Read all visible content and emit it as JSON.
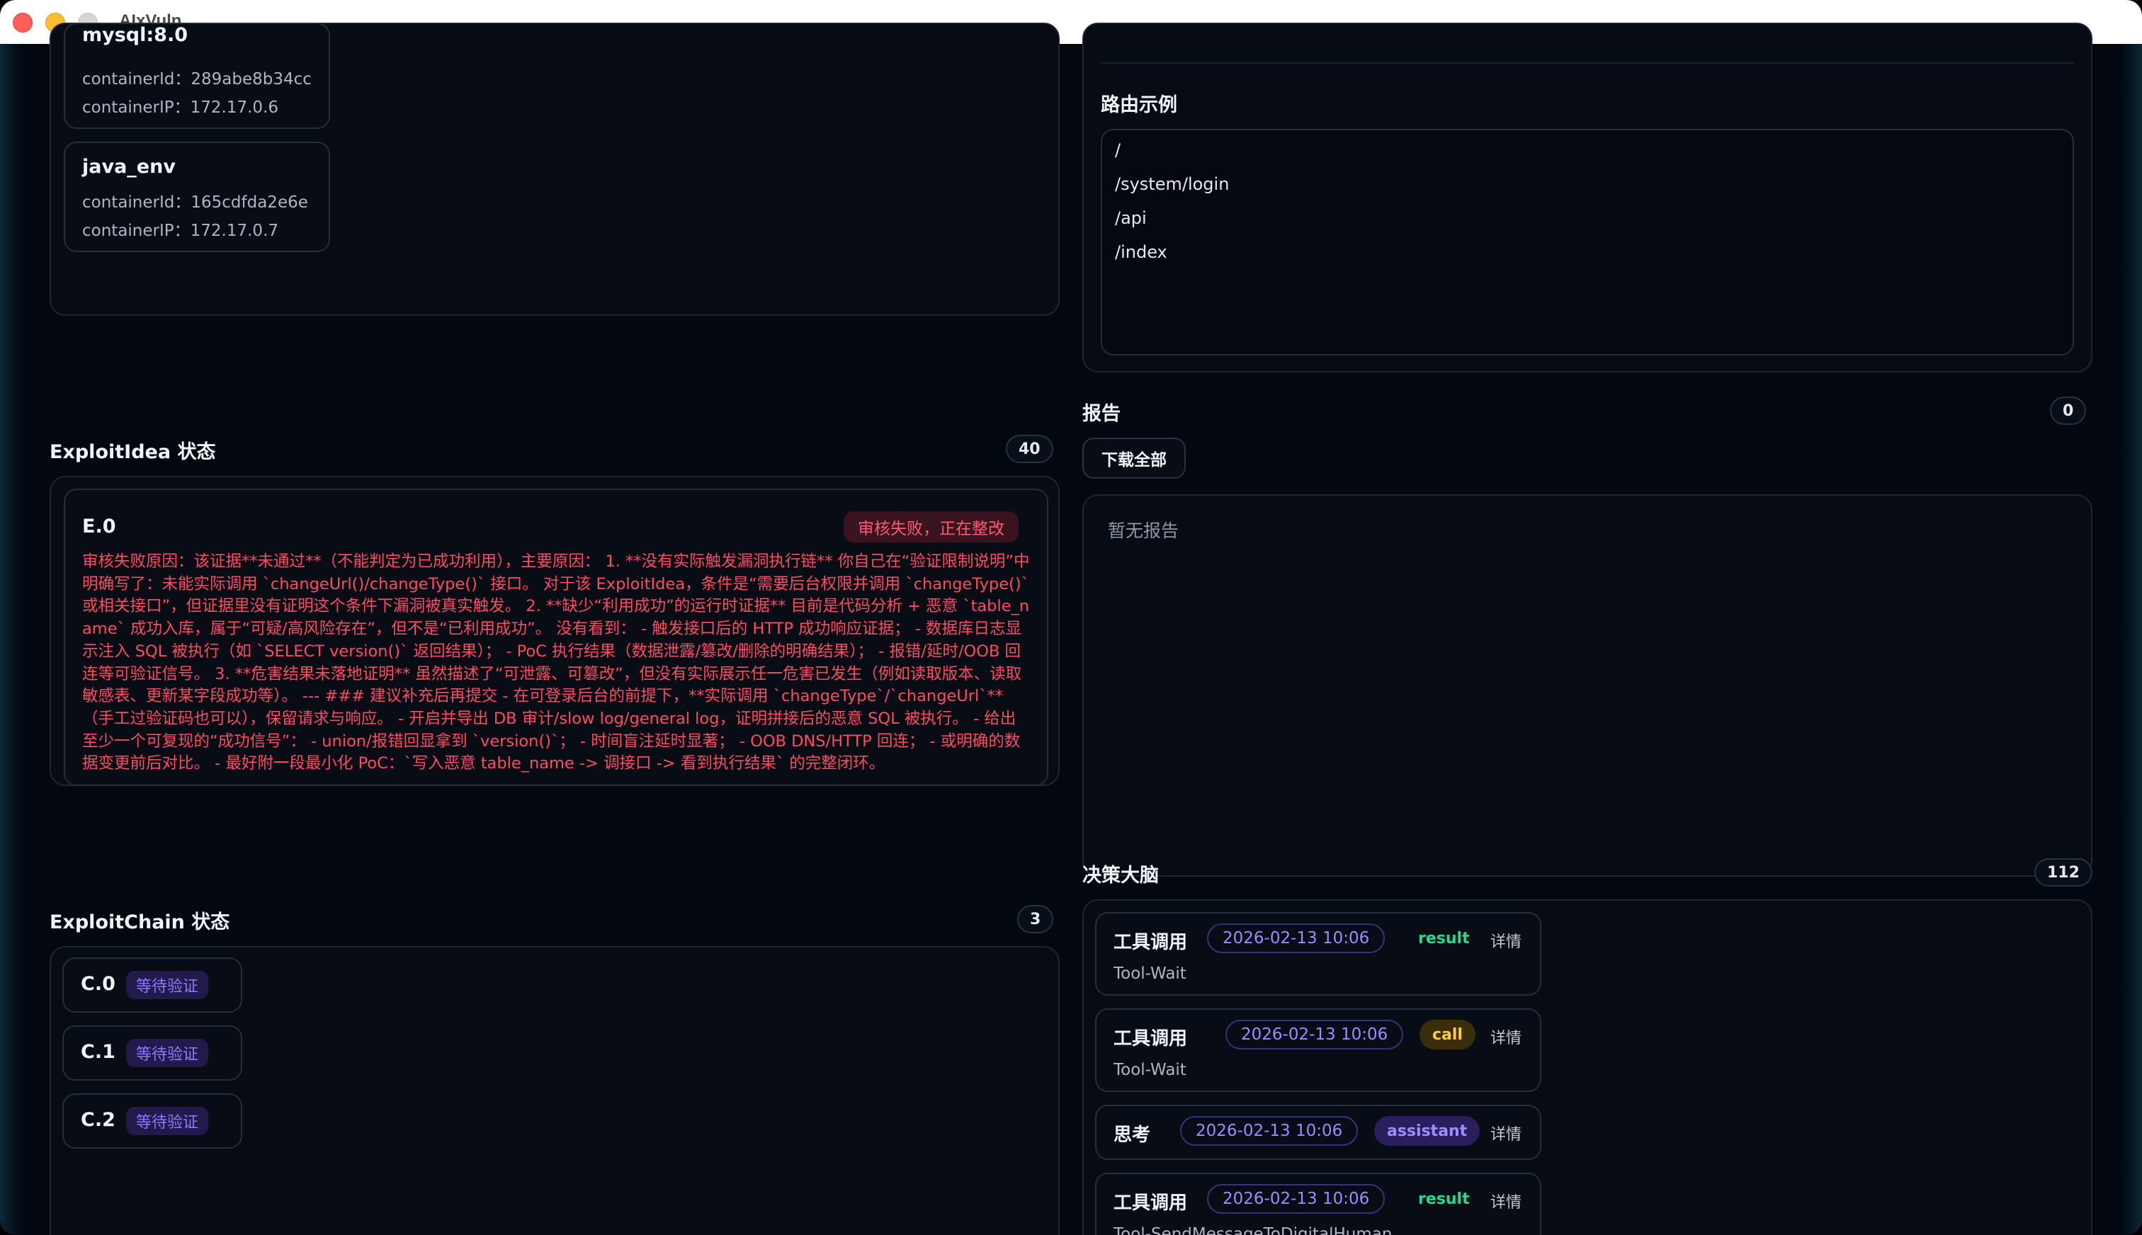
{
  "window": {
    "title": "AIxVuln"
  },
  "containers": [
    {
      "name": "mysql:8.0",
      "id_label": "containerId：",
      "id": "289abe8b34cc",
      "ip_label": "containerIP：",
      "ip": "172.17.0.6"
    },
    {
      "name": "java_env",
      "id_label": "containerId：",
      "id": "165cdfda2e6e",
      "ip_label": "containerIP：",
      "ip": "172.17.0.7"
    }
  ],
  "routes": {
    "title": "路由示例",
    "items": [
      "/",
      "/system/login",
      "/api",
      "/index"
    ]
  },
  "report": {
    "title": "报告",
    "count": "0",
    "download_label": "下载全部",
    "empty_text": "暂无报告"
  },
  "exploit_idea": {
    "title": "ExploitIdea 状态",
    "count": "40",
    "items": [
      {
        "id": "E.0",
        "status": "审核失败，正在整改",
        "text": "审核失败原因：该证据**未通过**（不能判定为已成功利用），主要原因： 1. **没有实际触发漏洞执行链** 你自己在“验证限制说明”中明确写了：未能实际调用 `changeUrl()/changeType()` 接口。 对于该 ExploitIdea，条件是“需要后台权限并调用 `changeType()` 或相关接口”，但证据里没有证明这个条件下漏洞被真实触发。 2. **缺少“利用成功”的运行时证据** 目前是代码分析 + 恶意 `table_name` 成功入库，属于“可疑/高风险存在”，但不是“已利用成功”。 没有看到： - 触发接口后的 HTTP 成功响应证据； - 数据库日志显示注入 SQL 被执行（如 `SELECT version()` 返回结果）； - PoC 执行结果（数据泄露/篡改/删除的明确结果）； - 报错/延时/OOB 回连等可验证信号。 3. **危害结果未落地证明** 虽然描述了“可泄露、可篡改”，但没有实际展示任一危害已发生（例如读取版本、读取敏感表、更新某字段成功等）。 --- ### 建议补充后再提交 - 在可登录后台的前提下，**实际调用 `changeType`/`changeUrl`**（手工过验证码也可以），保留请求与响应。 - 开启并导出 DB 审计/slow log/general log，证明拼接后的恶意 SQL 被执行。 - 给出至少一个可复现的“成功信号”： - union/报错回显拿到 `version()`； - 时间盲注延时显著； - OOB DNS/HTTP 回连； - 或明确的数据变更前后对比。 - 最好附一段最小化 PoC：`写入恶意 table_name -> 调接口 -> 看到执行结果` 的完整闭环。"
      }
    ]
  },
  "exploit_chain": {
    "title": "ExploitChain 状态",
    "count": "3",
    "items": [
      {
        "id": "C.0",
        "status": "等待验证"
      },
      {
        "id": "C.1",
        "status": "等待验证"
      },
      {
        "id": "C.2",
        "status": "等待验证"
      }
    ]
  },
  "decision": {
    "title": "决策大脑",
    "count": "112",
    "detail_label": "详情",
    "items": [
      {
        "kind": "工具调用",
        "time": "2026-02-13 10:06",
        "tag": "result",
        "sub": "Tool-Wait"
      },
      {
        "kind": "工具调用",
        "time": "2026-02-13 10:06",
        "tag": "call",
        "sub": "Tool-Wait"
      },
      {
        "kind": "思考",
        "time": "2026-02-13 10:06",
        "tag": "assistant",
        "sub": ""
      },
      {
        "kind": "工具调用",
        "time": "2026-02-13 10:06",
        "tag": "result",
        "sub": "Tool-SendMessageToDigitalHuman"
      }
    ]
  },
  "colors": {
    "background": "#03070f",
    "danger": "#ff4a63",
    "accent_purple": "#8d7bff",
    "result_green": "#27d88f",
    "call_yellow": "#ffcc3a"
  }
}
